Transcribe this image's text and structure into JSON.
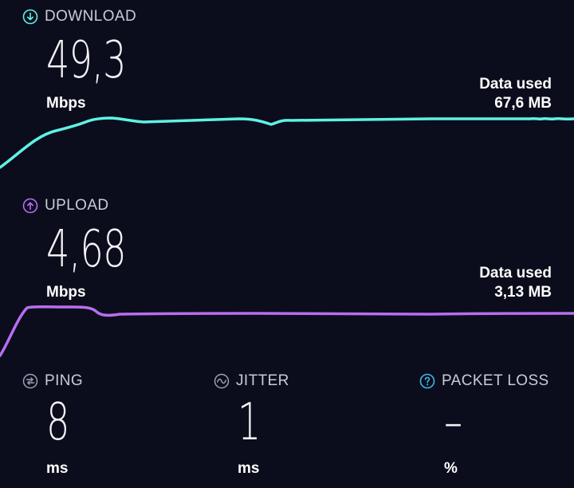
{
  "colors": {
    "background": "#0b0d1c",
    "download_accent": "#5ff2e4",
    "upload_accent": "#b86ef0",
    "label_gray": "#c9cbd6",
    "packet_loss_accent": "#3fb5ea"
  },
  "download": {
    "label": "DOWNLOAD",
    "icon": "arrow-down-circle-icon",
    "value": "49,3",
    "unit": "Mbps",
    "data_used_label": "Data used",
    "data_used_value": "67,6 MB"
  },
  "upload": {
    "label": "UPLOAD",
    "icon": "arrow-up-circle-icon",
    "value": "4,68",
    "unit": "Mbps",
    "data_used_label": "Data used",
    "data_used_value": "3,13 MB"
  },
  "metrics": [
    {
      "label": "PING",
      "icon": "ping-icon",
      "value": "8",
      "unit": "ms"
    },
    {
      "label": "JITTER",
      "icon": "jitter-icon",
      "value": "1",
      "unit": "ms"
    },
    {
      "label": "PACKET LOSS",
      "icon": "question-circle-icon",
      "value": "–",
      "unit": "%"
    }
  ]
}
